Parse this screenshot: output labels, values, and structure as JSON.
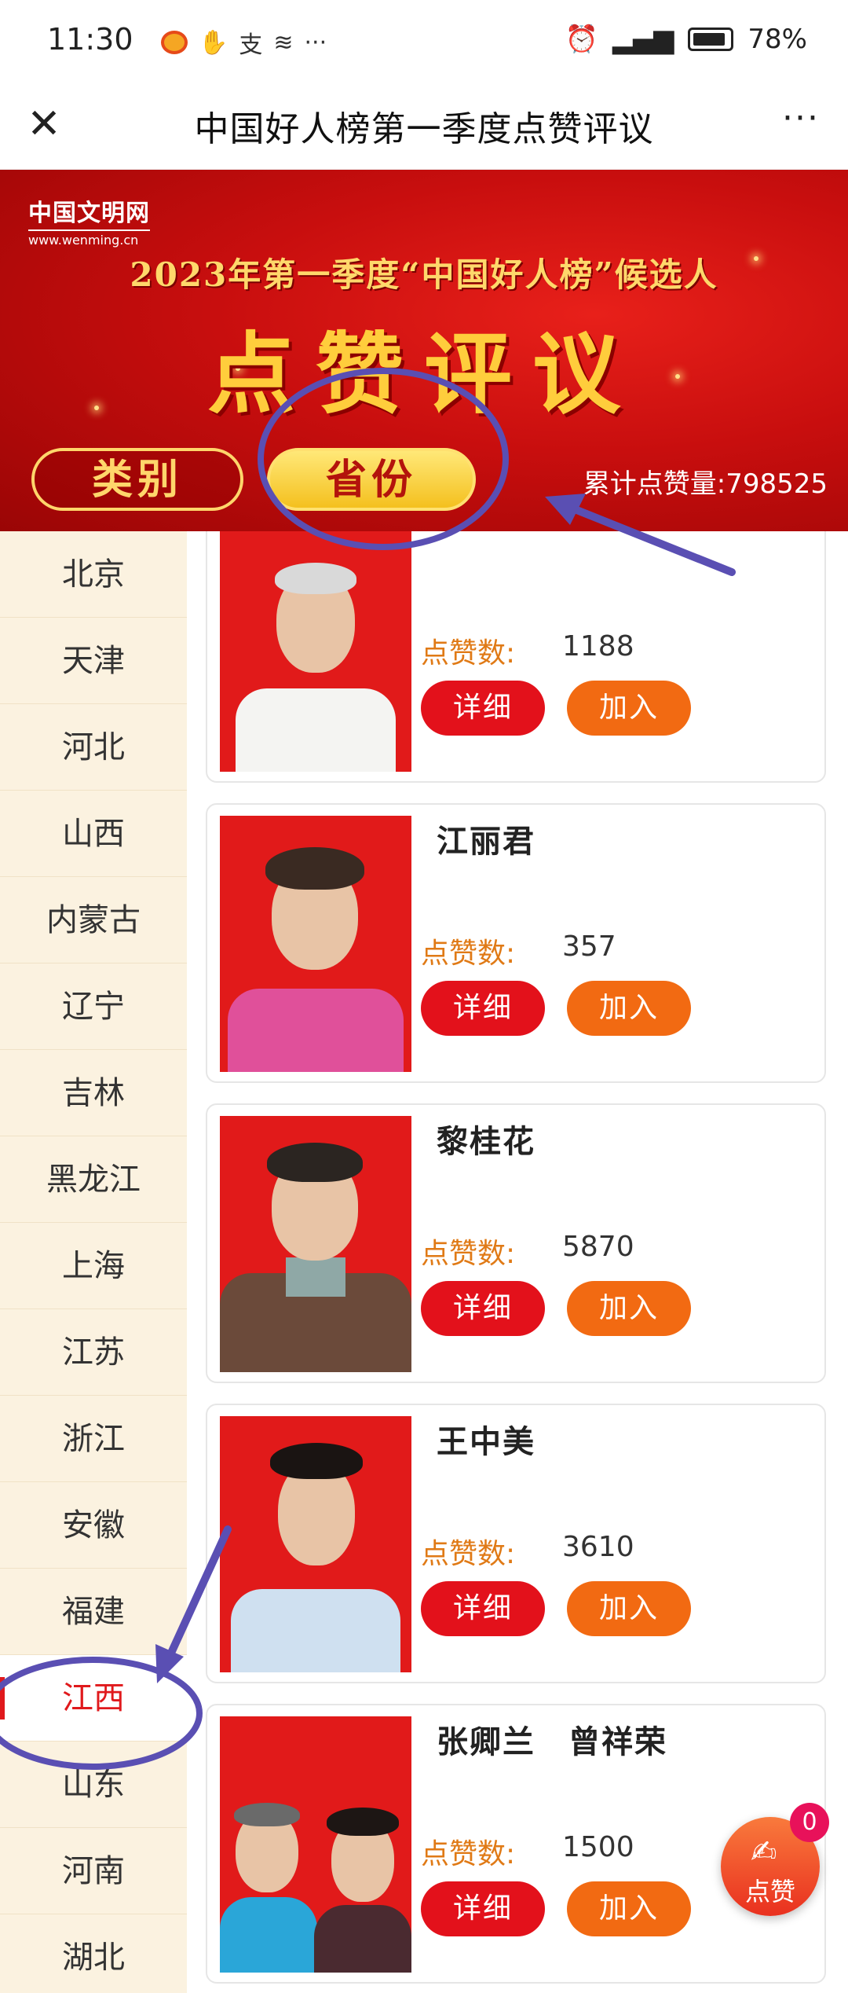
{
  "status_bar": {
    "time": "11:30",
    "icons_left": [
      "weibo-icon",
      "hand-icon",
      "alipay-icon",
      "wifi-icon",
      "more-icon"
    ],
    "more": "···",
    "battery": "78%"
  },
  "title_bar": {
    "title": "中国好人榜第一季度点赞评议",
    "close": "✕",
    "more": "···"
  },
  "banner": {
    "site_name": "中国文明网",
    "site_url": "www.wenming.cn",
    "subtitle": "2023年第一季度“中国好人榜”候选人",
    "headline": "点赞评议",
    "tabs": [
      {
        "label": "类别",
        "active": false
      },
      {
        "label": "省份",
        "active": true
      }
    ],
    "total_likes": "累计点赞量:798525"
  },
  "sidebar": {
    "items": [
      "北京",
      "天津",
      "河北",
      "山西",
      "内蒙古",
      "辽宁",
      "吉林",
      "黑龙江",
      "上海",
      "江苏",
      "浙江",
      "安徽",
      "福建",
      "江西",
      "山东",
      "河南",
      "湖北"
    ],
    "active": "江西"
  },
  "candidates": [
    {
      "name": "",
      "likes_label": "点赞数:",
      "likes": "1188",
      "detail": "详细",
      "join": "加入"
    },
    {
      "name": "江丽君",
      "likes_label": "点赞数:",
      "likes": "357",
      "detail": "详细",
      "join": "加入"
    },
    {
      "name": "黎桂花",
      "likes_label": "点赞数:",
      "likes": "5870",
      "detail": "详细",
      "join": "加入"
    },
    {
      "name": "王中美",
      "likes_label": "点赞数:",
      "likes": "3610",
      "detail": "详细",
      "join": "加入"
    },
    {
      "name": "张卿兰　曾祥荣",
      "likes_label": "点赞数:",
      "likes": "1500",
      "detail": "详细",
      "join": "加入"
    }
  ],
  "fab": {
    "label": "点赞",
    "badge": "0",
    "icon": "vote-icon"
  },
  "colors": {
    "brand_red": "#e0191c",
    "orange": "#f26a12",
    "banner_gold": "#ffcd3c",
    "annotation": "#5a4fb3"
  }
}
